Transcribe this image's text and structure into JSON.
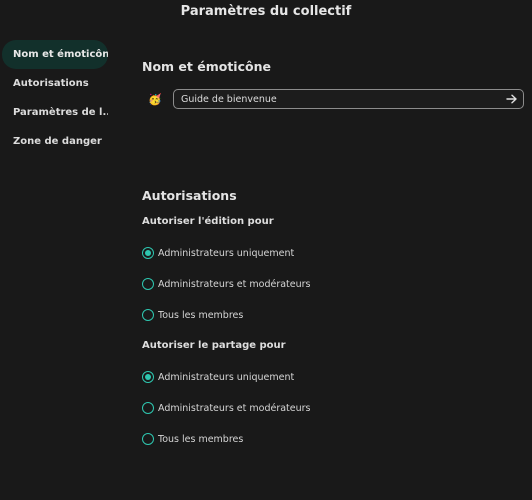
{
  "window": {
    "title": "Paramètres du collectif"
  },
  "sidebar": {
    "items": [
      {
        "label": "Nom et émoticône",
        "active": true
      },
      {
        "label": "Autorisations",
        "active": false
      },
      {
        "label": "Paramètres de l...",
        "active": false
      },
      {
        "label": "Zone de danger",
        "active": false
      }
    ]
  },
  "name_section": {
    "heading": "Nom et émoticône",
    "emoji": "🥳",
    "name_value": "Guide de bienvenue",
    "submit_icon": "arrow-right-icon"
  },
  "permissions": {
    "heading": "Autorisations",
    "edit": {
      "label": "Autoriser l'édition pour",
      "selected": 0,
      "options": [
        "Administrateurs uniquement",
        "Administrateurs et modérateurs",
        "Tous les membres"
      ]
    },
    "share": {
      "label": "Autoriser le partage pour",
      "selected": 0,
      "options": [
        "Administrateurs uniquement",
        "Administrateurs et modérateurs",
        "Tous les membres"
      ]
    }
  },
  "colors": {
    "accent": "#2ec7b0",
    "active_nav_bg": "#12302b",
    "background": "#191919"
  }
}
